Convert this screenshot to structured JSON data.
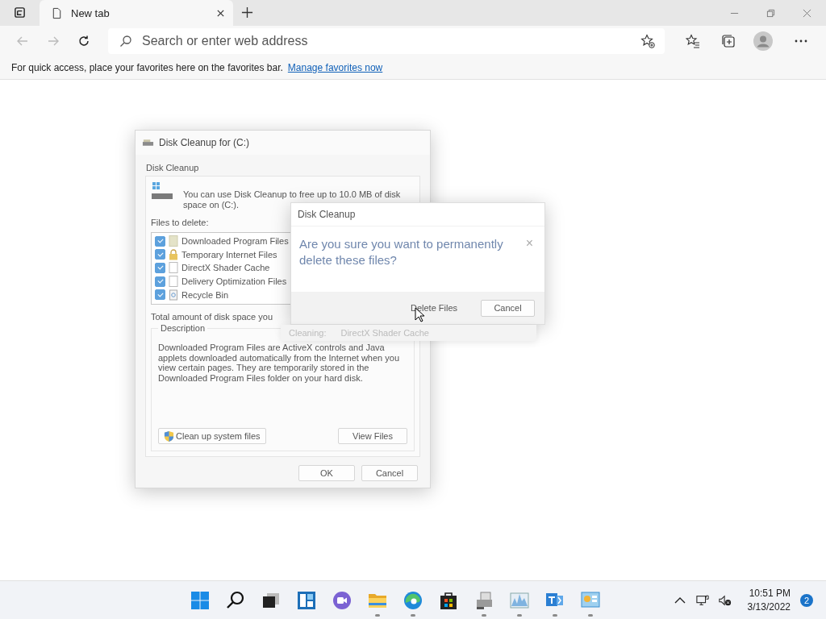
{
  "browser": {
    "tabs": [
      {
        "title": "New tab",
        "selected": true
      }
    ],
    "address_placeholder": "Search or enter web address",
    "favorites_bar": {
      "message": "For quick access, place your favorites here on the favorites bar.",
      "link": "Manage favorites now"
    }
  },
  "cleanup_dialog": {
    "title": "Disk Cleanup for  (C:)",
    "tab": "Disk Cleanup",
    "intro": "You can use Disk Cleanup to free up to 10.0 MB of disk space on  (C:).",
    "files_label": "Files to delete:",
    "files": [
      {
        "name": "Downloaded Program Files",
        "kind": "blank",
        "checked": true
      },
      {
        "name": "Temporary Internet Files",
        "kind": "lock",
        "checked": true
      },
      {
        "name": "DirectX Shader Cache",
        "kind": "page",
        "checked": true
      },
      {
        "name": "Delivery Optimization Files",
        "kind": "page",
        "checked": true
      },
      {
        "name": "Recycle Bin",
        "kind": "bin",
        "checked": true
      }
    ],
    "total_label": "Total amount of disk space you",
    "description_label": "Description",
    "description": "Downloaded Program Files are ActiveX controls and Java applets downloaded automatically from the Internet when you view certain pages. They are temporarily stored in the Downloaded Program Files folder on your hard disk.",
    "system_button": "Clean up system files",
    "view_button": "View Files",
    "buttons": [
      "OK",
      "Cancel"
    ]
  },
  "confirm_dialog": {
    "title": "Disk Cleanup",
    "question": "Are you sure you want to permanently delete these files?",
    "close": "×",
    "buttons": [
      "Delete Files",
      "Cancel"
    ]
  },
  "progress": {
    "label": "Cleaning:",
    "item": "DirectX Shader Cache"
  },
  "taskbar": {
    "apps": [
      {
        "kind": "start",
        "running": false
      },
      {
        "kind": "search",
        "running": false
      },
      {
        "kind": "taskview",
        "running": false
      },
      {
        "kind": "widgets",
        "running": false
      },
      {
        "kind": "chat",
        "running": false
      },
      {
        "kind": "folder",
        "running": true
      },
      {
        "kind": "edge",
        "running": true
      },
      {
        "kind": "store",
        "running": false
      },
      {
        "kind": "printer",
        "running": true
      },
      {
        "kind": "monitor",
        "running": true
      },
      {
        "kind": "teams",
        "running": true
      },
      {
        "kind": "dashboard",
        "running": true
      }
    ],
    "time": "10:51 PM",
    "date": "3/13/2022",
    "notifications": "2"
  }
}
